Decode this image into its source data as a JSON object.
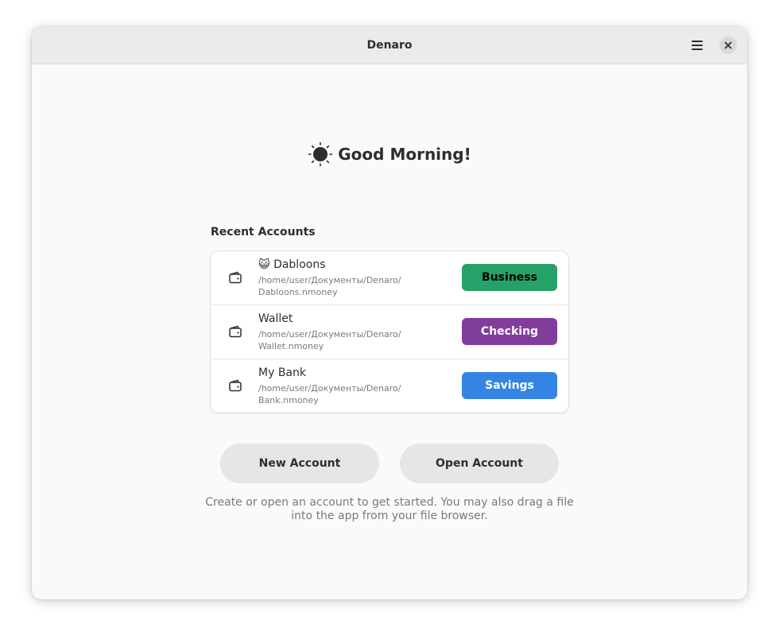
{
  "window": {
    "title": "Denaro",
    "menu_icon": "hamburger-menu-icon",
    "close_icon": "close-icon"
  },
  "greeting": {
    "icon": "sun-icon",
    "text": "Good Morning!"
  },
  "recent": {
    "label": "Recent Accounts",
    "accounts": [
      {
        "emoji": "😺",
        "name": "Dabloons",
        "path_line1": "/home/user/Документы/Denaro/",
        "path_line2": "Dabloons.nmoney",
        "type": "Business",
        "type_color": "#26a269",
        "type_text_color": "#000000"
      },
      {
        "emoji": "",
        "name": "Wallet",
        "path_line1": "/home/user/Документы/Denaro/",
        "path_line2": "Wallet.nmoney",
        "type": "Checking",
        "type_color": "#813d9c",
        "type_text_color": "#ffffff"
      },
      {
        "emoji": "",
        "name": "My Bank",
        "path_line1": "/home/user/Документы/Denaro/",
        "path_line2": "Bank.nmoney",
        "type": "Savings",
        "type_color": "#3584e4",
        "type_text_color": "#ffffff"
      }
    ]
  },
  "actions": {
    "new_account": "New Account",
    "open_account": "Open Account"
  },
  "hint": "Create or open an account to get started. You may also drag a file into the app from your file browser."
}
